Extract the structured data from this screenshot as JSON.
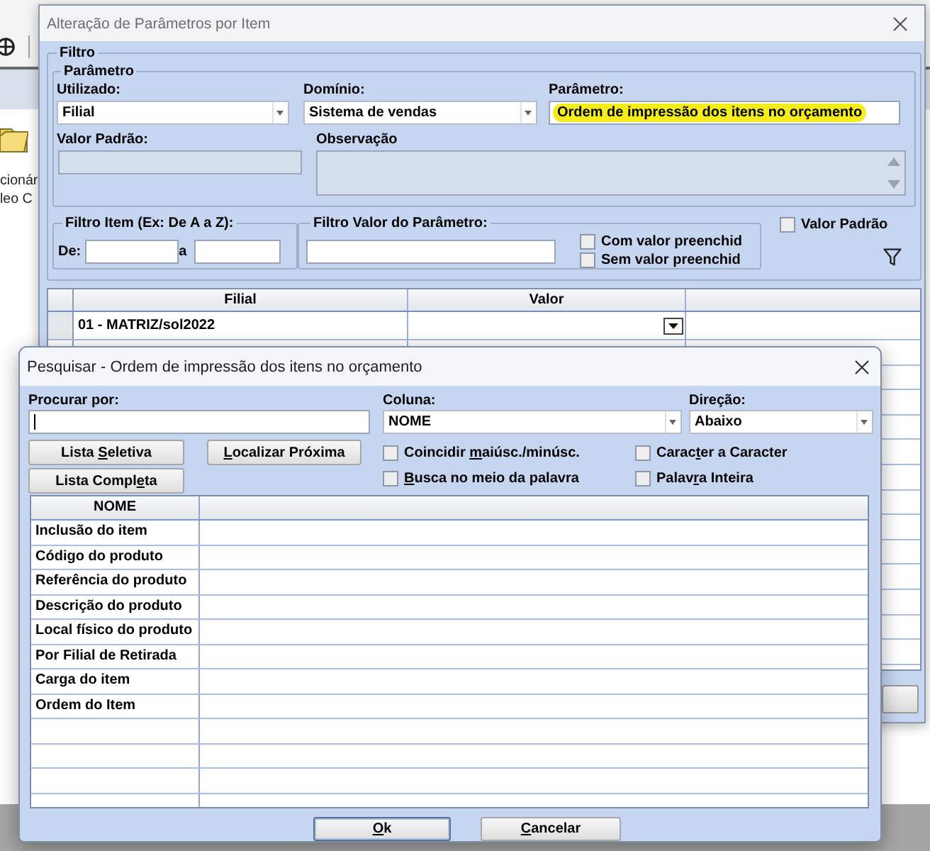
{
  "background_app": {
    "panel_texts": [
      "cionár",
      "leo C"
    ]
  },
  "main_dialog": {
    "title": "Alteração de Parâmetros por Item",
    "filter": {
      "title": "Filtro",
      "parameter_group": {
        "title": "Parâmetro",
        "used_by": {
          "label": "Utilizado:",
          "value": "Filial"
        },
        "domain": {
          "label": "Domínio:",
          "value": "Sistema de vendas"
        },
        "parameter": {
          "label": "Parâmetro:",
          "value": "Ordem de impressão dos itens no orçamento",
          "highlighted": true
        },
        "default_value": {
          "label": "Valor Padrão:",
          "disabled": true
        },
        "observation": {
          "label": "Observação",
          "disabled": true
        }
      },
      "item_filter": {
        "title": "Filtro Item (Ex: De A a Z):",
        "from_label": "De:",
        "to_label": "a"
      },
      "value_filter": {
        "title": "Filtro Valor do Parâmetro:",
        "options": [
          {
            "label": "Com valor preenchid",
            "checked": false
          },
          {
            "label": "Sem valor preenchid",
            "checked": false
          }
        ]
      },
      "default_value_check": {
        "label": "Valor Padrão",
        "checked": false
      }
    },
    "grid": {
      "columns": [
        "Filial",
        "Valor"
      ],
      "rows": [
        {
          "filial": "01 - MATRIZ/sol2022"
        }
      ]
    }
  },
  "search_dialog": {
    "title": "Pesquisar - Ordem de impressão dos itens no orçamento",
    "search_field": {
      "label": "Procurar por:",
      "focused": true
    },
    "column": {
      "label": "Coluna:",
      "value": "NOME"
    },
    "direction": {
      "label": "Direção:",
      "value": "Abaixo"
    },
    "buttons": [
      {
        "label": {
          "before": "Lista ",
          "key": "S",
          "after": "eletiva"
        }
      },
      {
        "label": {
          "key": "L",
          "after": "ocalizar Próxima"
        }
      },
      {
        "label": {
          "before": "Lista Compl",
          "key": "e",
          "after": "ta"
        }
      }
    ],
    "options": [
      {
        "label": {
          "before": "Coincidir ",
          "key": "m",
          "after": "aiúsc./minúsc."
        },
        "checked": false
      },
      {
        "label": {
          "before": "Carac",
          "key": "t",
          "after": "er a Caracter"
        },
        "checked": false
      },
      {
        "label": {
          "key": "B",
          "after": "usca no meio da palavra"
        },
        "checked": false
      },
      {
        "label": {
          "before": "Palav",
          "key": "r",
          "after": "a Inteira"
        },
        "checked": false
      }
    ],
    "table": {
      "columns": [
        "NOME"
      ],
      "rows": [
        {
          "nome": "Inclusão do item"
        },
        {
          "nome": "Código do produto"
        },
        {
          "nome": "Referência do produto"
        },
        {
          "nome": "Descrição do produto"
        },
        {
          "nome": "Local físico do produto"
        },
        {
          "nome": "Por Filial de Retirada"
        },
        {
          "nome": "Carga do item"
        },
        {
          "nome": "Ordem do Item"
        }
      ]
    },
    "footer_buttons": [
      {
        "label": {
          "key": "O",
          "after": "k"
        },
        "default": true
      },
      {
        "label": {
          "key": "C",
          "after": "ancelar"
        },
        "default": false
      }
    ]
  }
}
